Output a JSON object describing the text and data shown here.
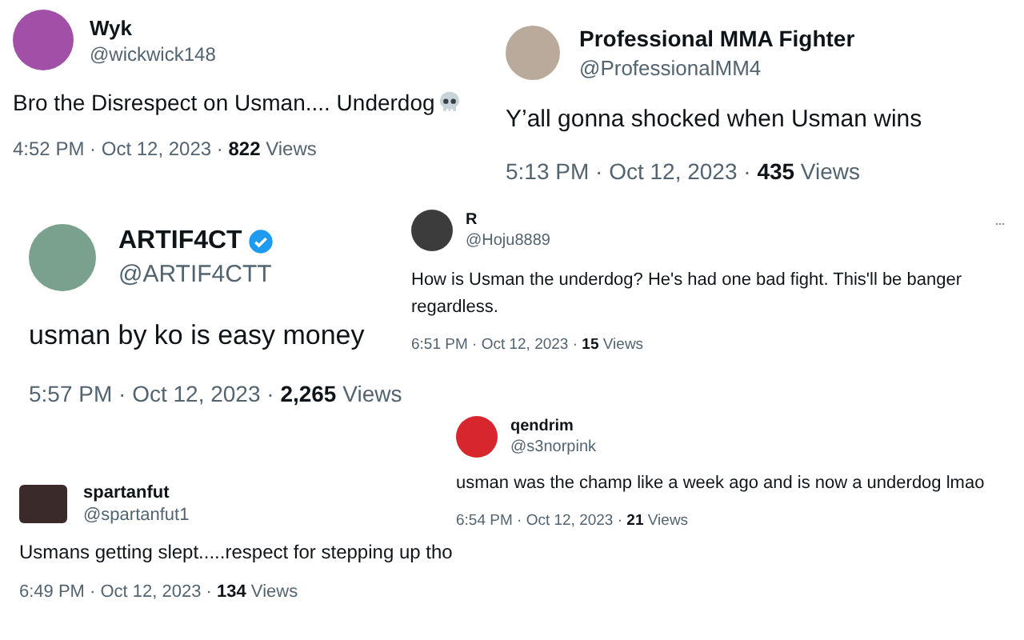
{
  "tweets": [
    {
      "name": "Wyk",
      "handle": "@wickwick148",
      "text": "Bro the Disrespect on Usman.... Underdog",
      "verified": false,
      "meta": "4:52 PM · Oct 12, 2023 · **822** Views"
    },
    {
      "name": "Professional MMA Fighter",
      "handle": "@ProfessionalMM4",
      "text": "Y’all gonna shocked when Usman wins",
      "verified": false,
      "meta": "5:13 PM · Oct 12, 2023 · **435** Views"
    },
    {
      "name": "ARTIF4CT",
      "handle": "@ARTIF4CTT",
      "text": "usman by ko is easy money",
      "verified": true,
      "meta": "5:57 PM · Oct 12, 2023 · **2,265** Views"
    },
    {
      "name": "R",
      "handle": "@Hoju8889",
      "text": "How is Usman the underdog? He's had one bad fight. This'll be banger regardless.",
      "verified": false,
      "meta": "6:51 PM · Oct 12, 2023 · **15** Views"
    },
    {
      "name": "qendrim",
      "handle": "@s3norpink",
      "text": "usman was the champ like a week ago and is now a underdog lmao",
      "verified": false,
      "meta": "6:54 PM · Oct 12, 2023 · **21** Views"
    },
    {
      "name": "spartanfut",
      "handle": "@spartanfut1",
      "text": "Usmans getting slept.....respect for stepping up tho",
      "verified": false,
      "meta": "6:49 PM · Oct 12, 2023 · **134** Views"
    }
  ]
}
